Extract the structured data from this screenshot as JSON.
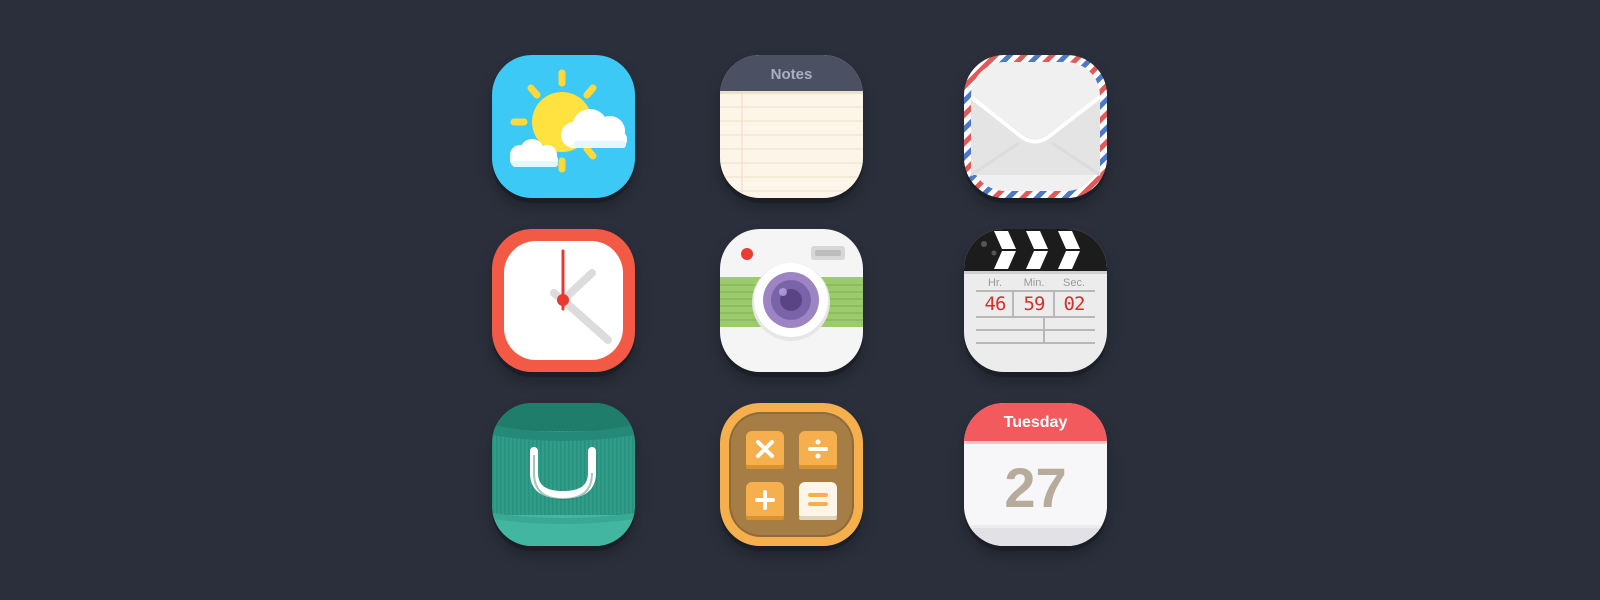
{
  "icons": {
    "weather": {
      "name": "weather-app"
    },
    "notes": {
      "title": "Notes"
    },
    "mail": {
      "name": "mail-app"
    },
    "clock": {
      "name": "clock-app"
    },
    "camera": {
      "name": "camera-app"
    },
    "video": {
      "labels": {
        "hr": "Hr.",
        "min": "Min.",
        "sec": "Sec."
      },
      "values": {
        "hr": "46",
        "min": "59",
        "sec": "02"
      }
    },
    "shop": {
      "name": "shopping-bag-app"
    },
    "calculator": {
      "symbols": [
        "×",
        "÷",
        "+",
        "="
      ]
    },
    "calendar": {
      "day": "Tuesday",
      "date": "27"
    }
  },
  "colors": {
    "background": "#2a2f3b",
    "weather_sky": "#3cc9f5",
    "clock_ring": "#f25a45",
    "calendar_red": "#f25a5e",
    "shop_green": "#2fa08d",
    "calc_orange": "#f5b04d"
  }
}
